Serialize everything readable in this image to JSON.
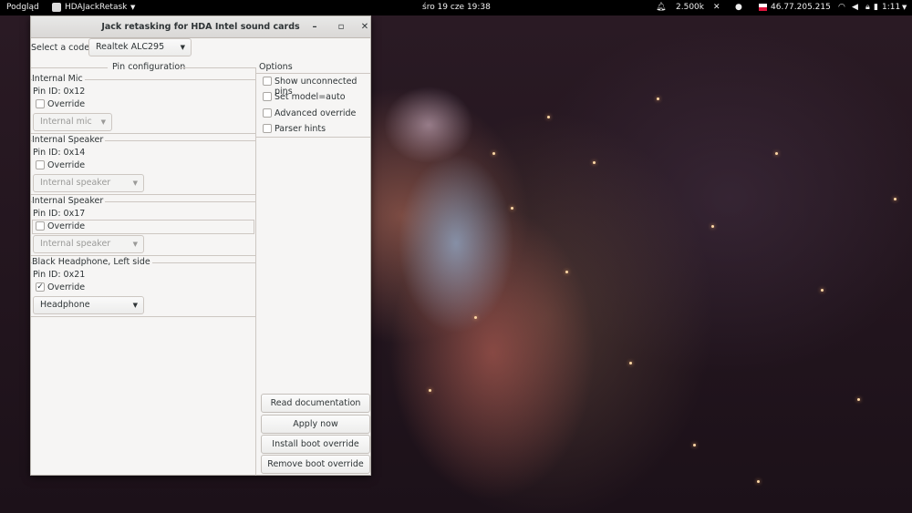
{
  "topbar": {
    "activities": "Podgląd",
    "app_menu": "HDAJackRetask",
    "clock": "śro 19 cze  19:38",
    "speed": "2.500k",
    "ip": "46.77.205.215",
    "time_small": "1:11"
  },
  "window": {
    "title": "Jack retasking for HDA Intel sound cards",
    "codec_label": "Select a codec:",
    "codec_value": "Realtek ALC295",
    "pin_config_title": "Pin configuration",
    "options_title": "Options",
    "pins": [
      {
        "name": "Internal Mic",
        "pin_id": "Pin ID: 0x12",
        "override_label": "Override",
        "override_checked": false,
        "combo_value": "Internal mic"
      },
      {
        "name": "Internal Speaker",
        "pin_id": "Pin ID: 0x14",
        "override_label": "Override",
        "override_checked": false,
        "combo_value": "Internal speaker"
      },
      {
        "name": "Internal Speaker",
        "pin_id": "Pin ID: 0x17",
        "override_label": "Override",
        "override_checked": false,
        "combo_value": "Internal speaker"
      },
      {
        "name": "Black Headphone, Left side",
        "pin_id": "Pin ID: 0x21",
        "override_label": "Override",
        "override_checked": true,
        "combo_value": "Headphone"
      }
    ],
    "options": [
      {
        "label": "Show unconnected pins",
        "checked": false
      },
      {
        "label": "Set model=auto",
        "checked": false
      },
      {
        "label": "Advanced override",
        "checked": false
      },
      {
        "label": "Parser hints",
        "checked": false
      }
    ],
    "buttons": {
      "read_docs": "Read documentation",
      "apply": "Apply now",
      "install": "Install boot override",
      "remove": "Remove boot override"
    }
  }
}
